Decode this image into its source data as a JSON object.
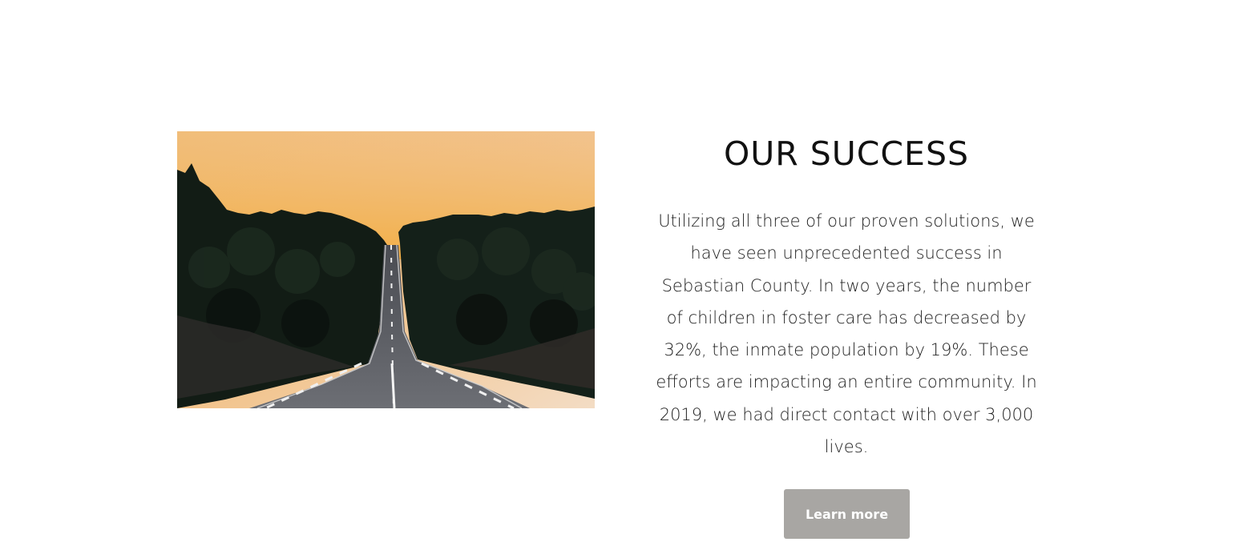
{
  "success_section": {
    "title": "OUR SUCCESS",
    "body": "Utilizing all three of our proven solutions, we have seen unprecedented success in Sebastian County.  In two years, the number of children in foster care has decreased by 32%, the inmate population by 19%. These efforts are impacting an entire community. In 2019, we had direct contact with over 3,000 lives.",
    "cta_label": "Learn more",
    "image_subject": "road-through-forest-at-sunset"
  },
  "colors": {
    "button_background": "#a8a6a3",
    "button_text": "#ffffff",
    "title_text": "#111111",
    "body_text": "#222222",
    "sky_top": "#f3d8b6",
    "sky_horizon": "#f2b24d",
    "forest": "#142018",
    "road": "#5c5e63"
  }
}
